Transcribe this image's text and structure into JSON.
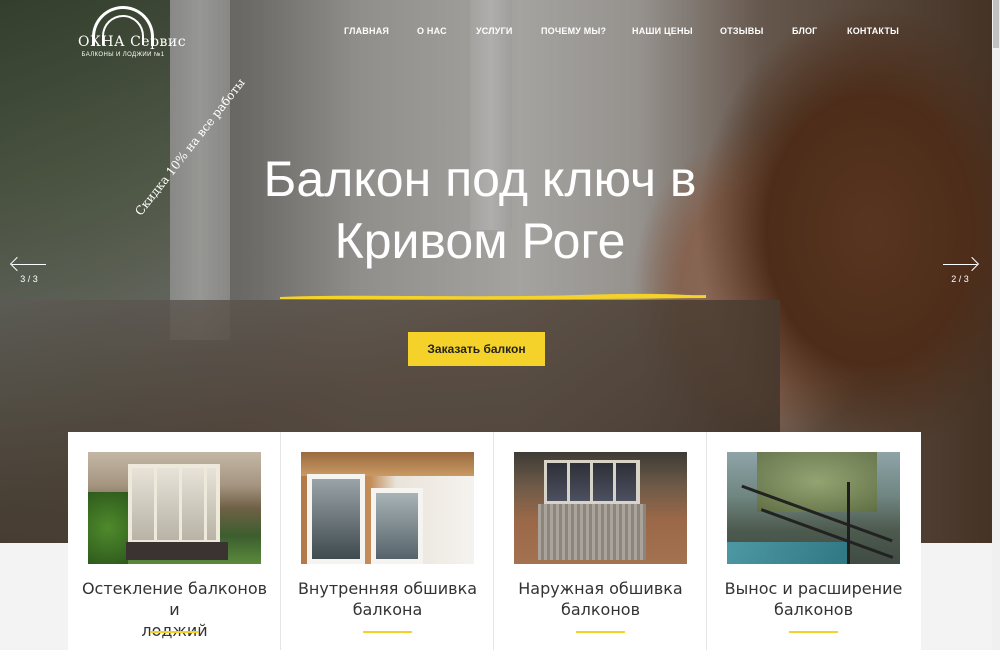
{
  "brand": {
    "name": "ОКНА Сервис",
    "tagline": "БАЛКОНЫ И ЛОДЖИИ №1"
  },
  "nav": {
    "items": [
      {
        "label": "ГЛАВНАЯ"
      },
      {
        "label": "О НАС"
      },
      {
        "label": "УСЛУГИ"
      },
      {
        "label": "ПОЧЕМУ МЫ?"
      },
      {
        "label": "НАШИ ЦЕНЫ"
      },
      {
        "label": "ОТЗЫВЫ"
      },
      {
        "label": "БЛОГ"
      },
      {
        "label": "КОНТАКТЫ"
      }
    ]
  },
  "hero": {
    "discount": "Скидка 10% на все работы",
    "headline_line1": "Балкон под ключ в",
    "headline_line2": "Кривом Роге",
    "cta_label": "Заказать балкон",
    "prev_counter": "3 / 3",
    "next_counter": "2 / 3",
    "accent_color": "#f5d22a"
  },
  "services": [
    {
      "title_line1": "Остекление балконов и",
      "title_line2": "лоджий",
      "image_icon": "glazed-balcony-photo"
    },
    {
      "title_line1": "Внутренняя обшивка",
      "title_line2": "балкона",
      "image_icon": "interior-lining-photo"
    },
    {
      "title_line1": "Наружная обшивка",
      "title_line2": "балконов",
      "image_icon": "exterior-cladding-photo"
    },
    {
      "title_line1": "Вынос и расширение",
      "title_line2": "балконов",
      "image_icon": "balcony-extension-photo"
    }
  ]
}
